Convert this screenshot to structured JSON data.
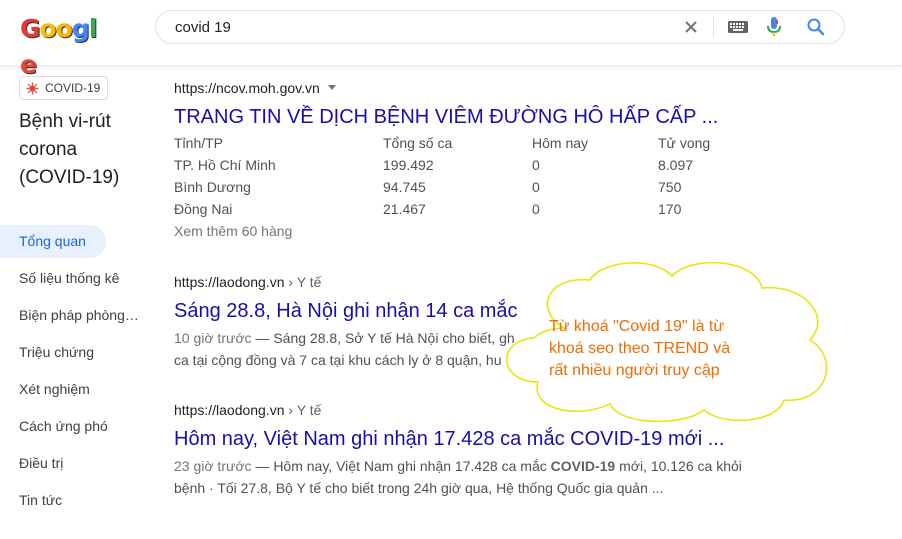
{
  "header": {
    "logo_letters": [
      "G",
      "o",
      "o",
      "g",
      "l",
      "e"
    ],
    "search_value": "covid 19"
  },
  "knowledge_panel": {
    "chip_label": "COVID-19",
    "title": "Bệnh vi-rút corona (COVID-19)",
    "nav": [
      {
        "label": "Tổng quan",
        "active": true
      },
      {
        "label": "Số liệu thống kê"
      },
      {
        "label": "Biện pháp phòng ngừa"
      },
      {
        "label": "Triệu chứng"
      },
      {
        "label": "Xét nghiệm"
      },
      {
        "label": "Cách ứng phó"
      },
      {
        "label": "Điều trị"
      },
      {
        "label": "Tin tức"
      }
    ]
  },
  "results": [
    {
      "url": "https://ncov.moh.gov.vn",
      "title": "TRANG TIN VỀ DỊCH BỆNH VIÊM ĐƯỜNG HÔ HẤP CẤP ...",
      "table": {
        "headers": [
          "Tỉnh/TP",
          "Tổng số ca",
          "Hôm nay",
          "Tử vong"
        ],
        "rows": [
          [
            "TP. Hồ Chí Minh",
            "199.492",
            "0",
            "8.097"
          ],
          [
            "Bình Dương",
            "94.745",
            "0",
            "750"
          ],
          [
            "Đồng Nai",
            "21.467",
            "0",
            "170"
          ]
        ]
      },
      "more_link": "Xem thêm 60 hàng"
    },
    {
      "url": "https://laodong.vn",
      "crumb": " › Y tế",
      "title": "Sáng 28.8, Hà Nội ghi nhận 14 ca mắc",
      "date": "10 giờ trước",
      "snippet_line1": " — Sáng 28.8, Sở Y tế Hà Nội cho biết, gh",
      "snippet_line2": "ca tại cộng đồng và 7 ca tại khu cách ly ở 8 quận, hu"
    },
    {
      "url": "https://laodong.vn",
      "crumb": " › Y tế",
      "title": "Hôm nay, Việt Nam ghi nhận 17.428 ca mắc COVID-19 mới ...",
      "date": "23 giờ trước",
      "snippet_line1_a": " — Hôm nay, Việt Nam ghi nhận 17.428 ca mắc ",
      "snippet_line1_bold": "COVID-19",
      "snippet_line1_b": " mới, 10.126 ca khỏi",
      "snippet_line2": "bệnh · Tối 27.8, Bộ Y tế cho biết trong 24h giờ qua, Hệ thống Quốc gia quản ..."
    }
  ],
  "callout": {
    "line1": "Từ khoá \"Covid 19\" là từ",
    "line2": "khoá seo theo TREND và",
    "line3": "rất nhiều người truy cập"
  },
  "colors": {
    "link": "#1a0dab",
    "active_nav_bg": "#e8f0fe",
    "active_nav_text": "#1967d2",
    "callout_fill": "#ffffff",
    "callout_border": "#e6e600",
    "callout_text": "#ef6c00"
  },
  "icons": {
    "clear": "close-icon",
    "keyboard": "keyboard-icon",
    "mic": "microphone-icon",
    "search": "search-icon",
    "covid": "virus-icon",
    "caret": "caret-down-icon"
  }
}
